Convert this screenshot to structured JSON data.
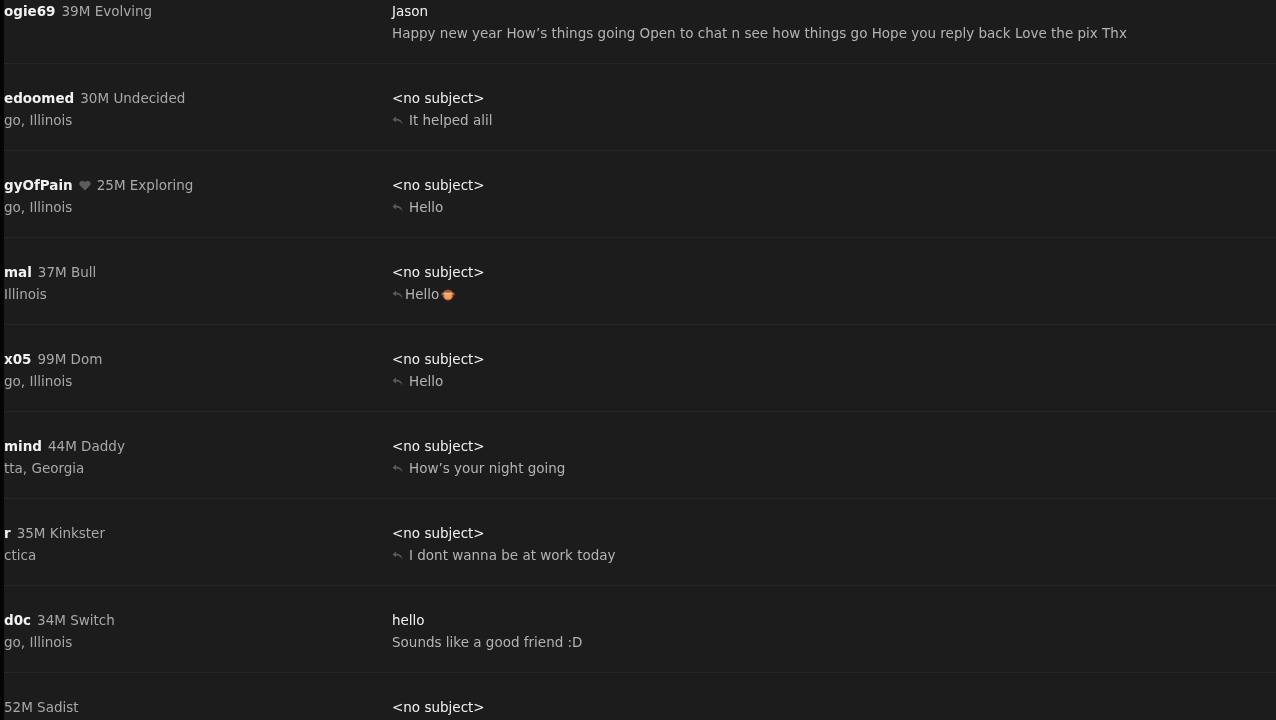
{
  "messages": [
    {
      "username": "ogie69",
      "heart": false,
      "details": "39M Evolving",
      "sender": "Jason",
      "preview": "Happy new year How’s things going Open to chat n see how things go Hope you reply back Love the pix Thx",
      "replied": false,
      "emoji": false
    },
    {
      "username": "edoomed",
      "heart": false,
      "details": "30M Undecided",
      "location": "go, Illinois",
      "subject": "<no subject>",
      "preview": "It helped alil",
      "replied": true,
      "emoji": false
    },
    {
      "username": "gyOfPain",
      "heart": true,
      "details": "25M Exploring",
      "location": "go, Illinois",
      "subject": "<no subject>",
      "preview": "Hello",
      "replied": true,
      "emoji": false
    },
    {
      "username": "mal",
      "heart": false,
      "details": "37M Bull",
      "location": "Illinois",
      "subject": "<no subject>",
      "preview": "Hello",
      "replied": true,
      "emoji": true
    },
    {
      "username": "x05",
      "heart": false,
      "details": "99M Dom",
      "location": "go, Illinois",
      "subject": "<no subject>",
      "preview": "Hello",
      "replied": true,
      "emoji": false
    },
    {
      "username": "mind",
      "heart": false,
      "details": "44M Daddy",
      "location": "tta, Georgia",
      "subject": "<no subject>",
      "preview": "How’s your night going",
      "replied": true,
      "emoji": false
    },
    {
      "username": "r",
      "heart": false,
      "details": "35M Kinkster",
      "location": "ctica",
      "subject": "<no subject>",
      "preview": "I dont wanna be at work today",
      "replied": true,
      "emoji": false
    },
    {
      "username": "d0c",
      "heart": false,
      "details": "34M Switch",
      "location": "go, Illinois",
      "subject": "hello",
      "preview": "Sounds like a good friend :D",
      "replied": false,
      "emoji": false
    },
    {
      "heart": false,
      "details": "52M Sadist",
      "subject": "<no subject>",
      "replied": false,
      "emoji": false
    }
  ]
}
